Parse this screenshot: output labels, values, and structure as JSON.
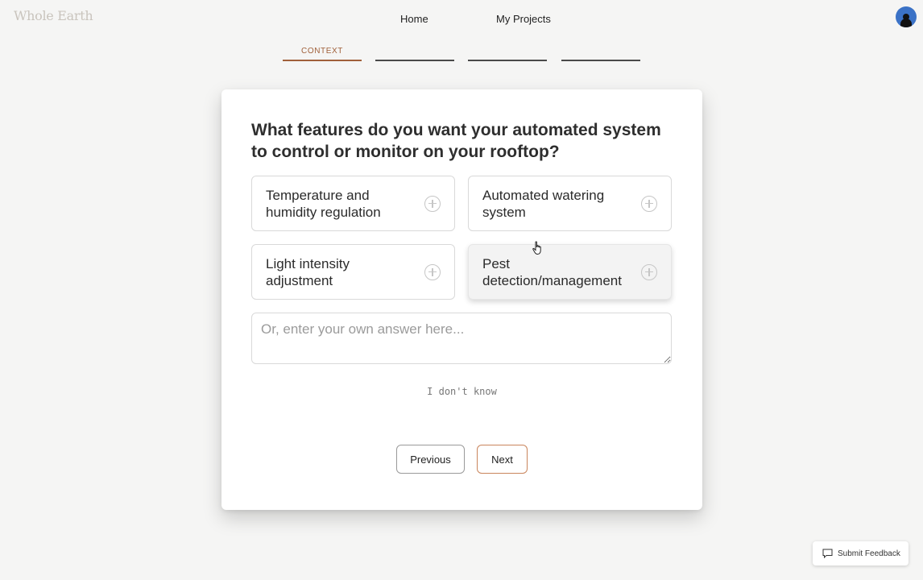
{
  "header": {
    "logo": "Whole Earth",
    "nav": {
      "home": "Home",
      "projects": "My Projects"
    }
  },
  "steps": {
    "active_label": "CONTEXT",
    "total": 4,
    "current": 1
  },
  "question": {
    "title": "What features do you want your automated system to control or monitor on your rooftop?",
    "options": [
      {
        "label": "Temperature and humidity regulation",
        "icon": "plus-circle-icon"
      },
      {
        "label": "Automated watering system",
        "icon": "plus-circle-icon"
      },
      {
        "label": "Light intensity adjustment",
        "icon": "plus-circle-icon"
      },
      {
        "label": "Pest detection/management",
        "icon": "plus-circle-icon"
      }
    ],
    "answer_placeholder": "Or, enter your own answer here...",
    "dont_know": "I don't know"
  },
  "buttons": {
    "previous": "Previous",
    "next": "Next"
  },
  "feedback": {
    "label": "Submit Feedback",
    "icon": "chat-bubble-icon"
  },
  "colors": {
    "accent": "#a0603a",
    "next_border": "#c9855c",
    "background": "#f5f5f4",
    "avatar": "#3b72c6"
  }
}
